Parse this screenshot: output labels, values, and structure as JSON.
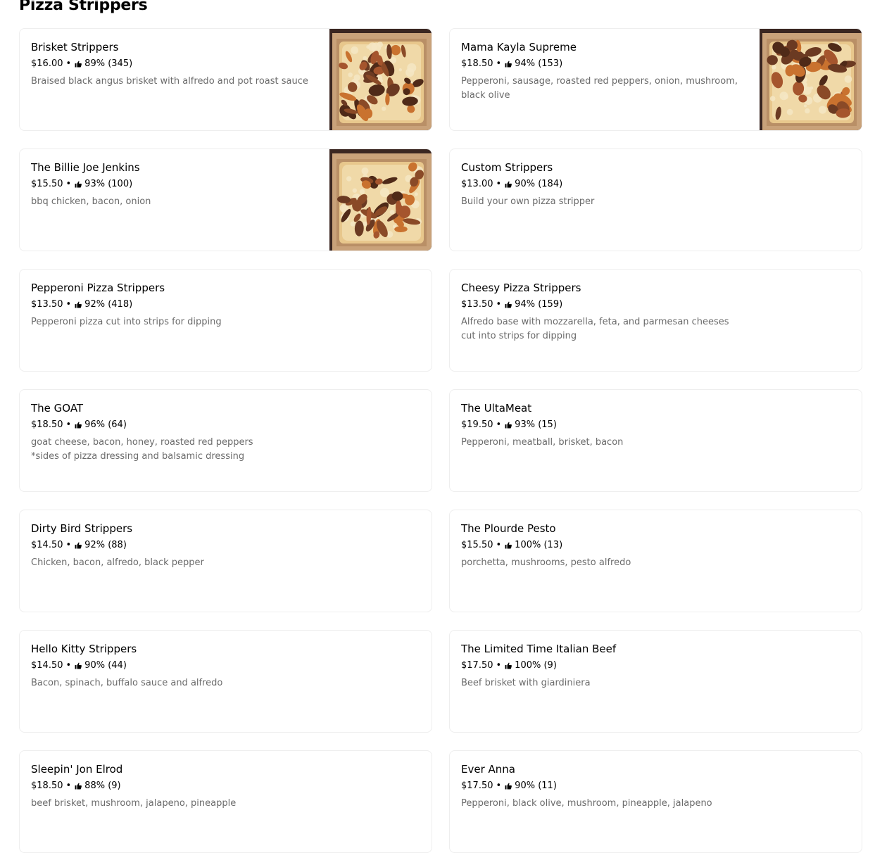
{
  "section": {
    "title": "Pizza Strippers"
  },
  "icons": {
    "rating": "thumbs-up-icon",
    "separator": "•"
  },
  "items": [
    {
      "name": "Brisket Strippers",
      "price": "$16.00",
      "rating": "89% (345)",
      "description": "Braised black angus brisket with alfredo and pot roast sauce",
      "has_image": true,
      "image": "brisket-pizza-in-box"
    },
    {
      "name": "Mama Kayla Supreme",
      "price": "$18.50",
      "rating": "94% (153)",
      "description": "Pepperoni, sausage, roasted red peppers, onion, mushroom, black olive",
      "has_image": true,
      "image": "supreme-pizza-in-box"
    },
    {
      "name": "The Billie Joe Jenkins",
      "price": "$15.50",
      "rating": "93% (100)",
      "description": "bbq chicken, bacon, onion",
      "has_image": true,
      "image": "bbq-pizza-in-box"
    },
    {
      "name": "Custom Strippers",
      "price": "$13.00",
      "rating": "90% (184)",
      "description": "Build your own pizza stripper",
      "has_image": false
    },
    {
      "name": "Pepperoni Pizza Strippers",
      "price": "$13.50",
      "rating": "92% (418)",
      "description": "Pepperoni pizza cut into strips for dipping",
      "has_image": false
    },
    {
      "name": "Cheesy Pizza Strippers",
      "price": "$13.50",
      "rating": "94% (159)",
      "description": "Alfredo base with mozzarella, feta, and parmesan cheeses cut into strips for dipping",
      "has_image": false
    },
    {
      "name": "The GOAT",
      "price": "$18.50",
      "rating": "96% (64)",
      "description": "goat cheese, bacon, honey, roasted red peppers\n*sides of pizza dressing and balsamic dressing",
      "has_image": false
    },
    {
      "name": "The UltaMeat",
      "price": "$19.50",
      "rating": "93% (15)",
      "description": "Pepperoni, meatball, brisket, bacon",
      "has_image": false
    },
    {
      "name": "Dirty Bird Strippers",
      "price": "$14.50",
      "rating": "92% (88)",
      "description": "Chicken, bacon, alfredo, black pepper",
      "has_image": false
    },
    {
      "name": "The Plourde Pesto",
      "price": "$15.50",
      "rating": "100% (13)",
      "description": "porchetta, mushrooms, pesto alfredo",
      "has_image": false
    },
    {
      "name": "Hello Kitty Strippers",
      "price": "$14.50",
      "rating": "90% (44)",
      "description": "Bacon, spinach, buffalo sauce and alfredo",
      "has_image": false
    },
    {
      "name": "The Limited Time Italian Beef",
      "price": "$17.50",
      "rating": "100% (9)",
      "description": "Beef brisket with giardiniera",
      "has_image": false
    },
    {
      "name": "Sleepin' Jon Elrod",
      "price": "$18.50",
      "rating": "88% (9)",
      "description": "beef brisket, mushroom, jalapeno, pineapple",
      "has_image": false
    },
    {
      "name": "Ever Anna",
      "price": "$17.50",
      "rating": "90% (11)",
      "description": "Pepperoni, black olive, mushroom, pineapple, jalapeno",
      "has_image": false
    }
  ]
}
